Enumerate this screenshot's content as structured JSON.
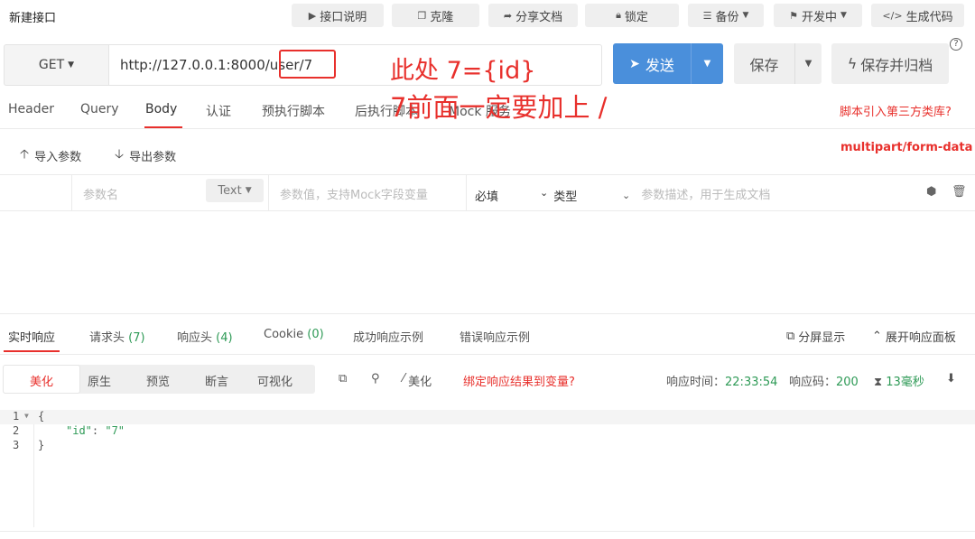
{
  "header": {
    "title": "新建接口",
    "buttons": {
      "doc": "接口说明",
      "clone": "克隆",
      "share": "分享文档",
      "lock": "锁定",
      "backup": "备份",
      "status": "开发中",
      "gen_code": "生成代码"
    }
  },
  "request": {
    "method": "GET",
    "url": "http://127.0.0.1:8000/user/7",
    "send_label": "发送",
    "save_label": "保存",
    "save_archive_label": "保存并归档",
    "help": "?"
  },
  "annotations": {
    "line1": "此处 7={id}",
    "line2": "7前面一定要加上 /"
  },
  "tabs": {
    "items": [
      "Header",
      "Query",
      "Body",
      "认证",
      "预执行脚本",
      "后执行脚本",
      "Mock 服务"
    ],
    "active": "Body",
    "script_link": "脚本引入第三方类库?"
  },
  "body": {
    "import_label": "导入参数",
    "export_label": "导出参数",
    "content_type": "multipart/form-data",
    "param_row": {
      "name_placeholder": "参数名",
      "type": "Text",
      "value_placeholder": "参数值，支持Mock字段变量",
      "required": "必填",
      "param_type": "类型",
      "desc_placeholder": "参数描述，用于生成文档"
    }
  },
  "response": {
    "tabs": {
      "realtime": "实时响应",
      "req_headers": "请求头",
      "req_headers_count": "(7)",
      "resp_headers": "响应头",
      "resp_headers_count": "(4)",
      "cookie": "Cookie",
      "cookie_count": "(0)",
      "success_example": "成功响应示例",
      "error_example": "错误响应示例"
    },
    "split_view": "分屏显示",
    "expand_panel": "展开响应面板",
    "format": {
      "beautify": "美化",
      "raw": "原生",
      "preview": "预览",
      "assert": "断言",
      "visualize": "可视化"
    },
    "beautify_tool": "美化",
    "bind_link": "绑定响应结果到变量?",
    "time_label": "响应时间：",
    "time_value": "22:33:54",
    "code_label": "响应码：",
    "code_value": "200",
    "duration_value": "13毫秒",
    "code_lines": [
      {
        "num": "1",
        "text": "{"
      },
      {
        "num": "2",
        "key": "\"id\"",
        "colon": ": ",
        "value": "\"7\""
      },
      {
        "num": "3",
        "text": "}"
      }
    ]
  },
  "colors": {
    "accent_red": "#e8302c",
    "send_blue": "#4a8fdb",
    "value_green": "#2e9a56"
  }
}
